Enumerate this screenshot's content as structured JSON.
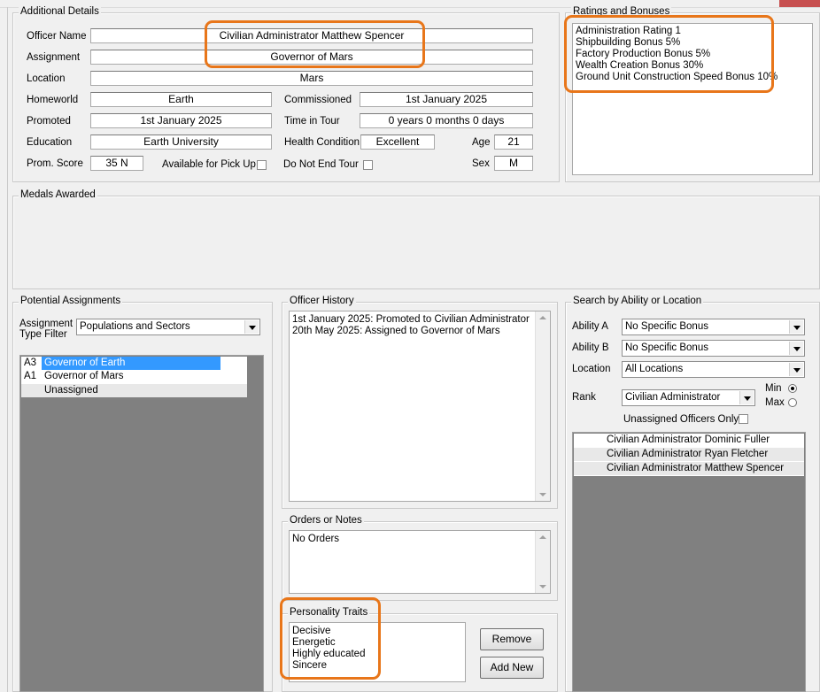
{
  "additional_details": {
    "legend": "Additional Details",
    "officer_name_label": "Officer Name",
    "officer_name": "Civilian Administrator Matthew Spencer",
    "assignment_label": "Assignment",
    "assignment": "Governor of Mars",
    "location_label": "Location",
    "location": "Mars",
    "homeworld_label": "Homeworld",
    "homeworld": "Earth",
    "commissioned_label": "Commissioned",
    "commissioned": "1st January 2025",
    "promoted_label": "Promoted",
    "promoted": "1st January 2025",
    "time_in_tour_label": "Time in Tour",
    "time_in_tour": "0 years 0 months 0 days",
    "education_label": "Education",
    "education": "Earth University",
    "health_label": "Health Condition",
    "health": "Excellent",
    "age_label": "Age",
    "age": "21",
    "prom_score_label": "Prom. Score",
    "prom_score": "35 N",
    "available_label": "Available for Pick Up",
    "do_not_end_label": "Do Not End Tour",
    "sex_label": "Sex",
    "sex": "M"
  },
  "ratings": {
    "legend": "Ratings and Bonuses",
    "lines": [
      "Administration Rating 1",
      "Shipbuilding Bonus 5%",
      "Factory Production Bonus 5%",
      "Wealth Creation Bonus 30%",
      "Ground Unit Construction Speed Bonus 10%"
    ]
  },
  "medals": {
    "legend": "Medals Awarded"
  },
  "potential_assignments": {
    "legend": "Potential Assignments",
    "filter_label_1": "Assignment",
    "filter_label_2": "Type Filter",
    "filter_value": "Populations and Sectors",
    "rows": [
      {
        "code": "A3",
        "name": "Governor of Earth"
      },
      {
        "code": "A1",
        "name": "Governor of Mars"
      },
      {
        "code": "",
        "name": "Unassigned"
      }
    ]
  },
  "officer_history": {
    "legend": "Officer History",
    "lines": [
      "1st January 2025: Promoted to Civilian Administrator",
      "20th May 2025: Assigned to Governor of Mars"
    ]
  },
  "orders": {
    "legend": "Orders or Notes",
    "text": "No Orders"
  },
  "personality": {
    "legend": "Personality Traits",
    "traits": [
      "Decisive",
      "Energetic",
      "Highly educated",
      "Sincere"
    ],
    "remove_label": "Remove",
    "add_label": "Add New"
  },
  "search": {
    "legend": "Search by Ability or Location",
    "ability_a_label": "Ability A",
    "ability_a": "No Specific Bonus",
    "ability_b_label": "Ability B",
    "ability_b": "No Specific Bonus",
    "location_label": "Location",
    "location": "All Locations",
    "rank_label": "Rank",
    "rank": "Civilian Administrator",
    "min_label": "Min",
    "max_label": "Max",
    "unassigned_label": "Unassigned Officers Only",
    "results": [
      "Civilian Administrator Dominic Fuller",
      "Civilian Administrator Ryan Fletcher",
      "Civilian Administrator Matthew Spencer"
    ]
  },
  "colors": {
    "highlight": "#e8761a",
    "selection": "#3399ff",
    "empty_list": "#808080"
  }
}
